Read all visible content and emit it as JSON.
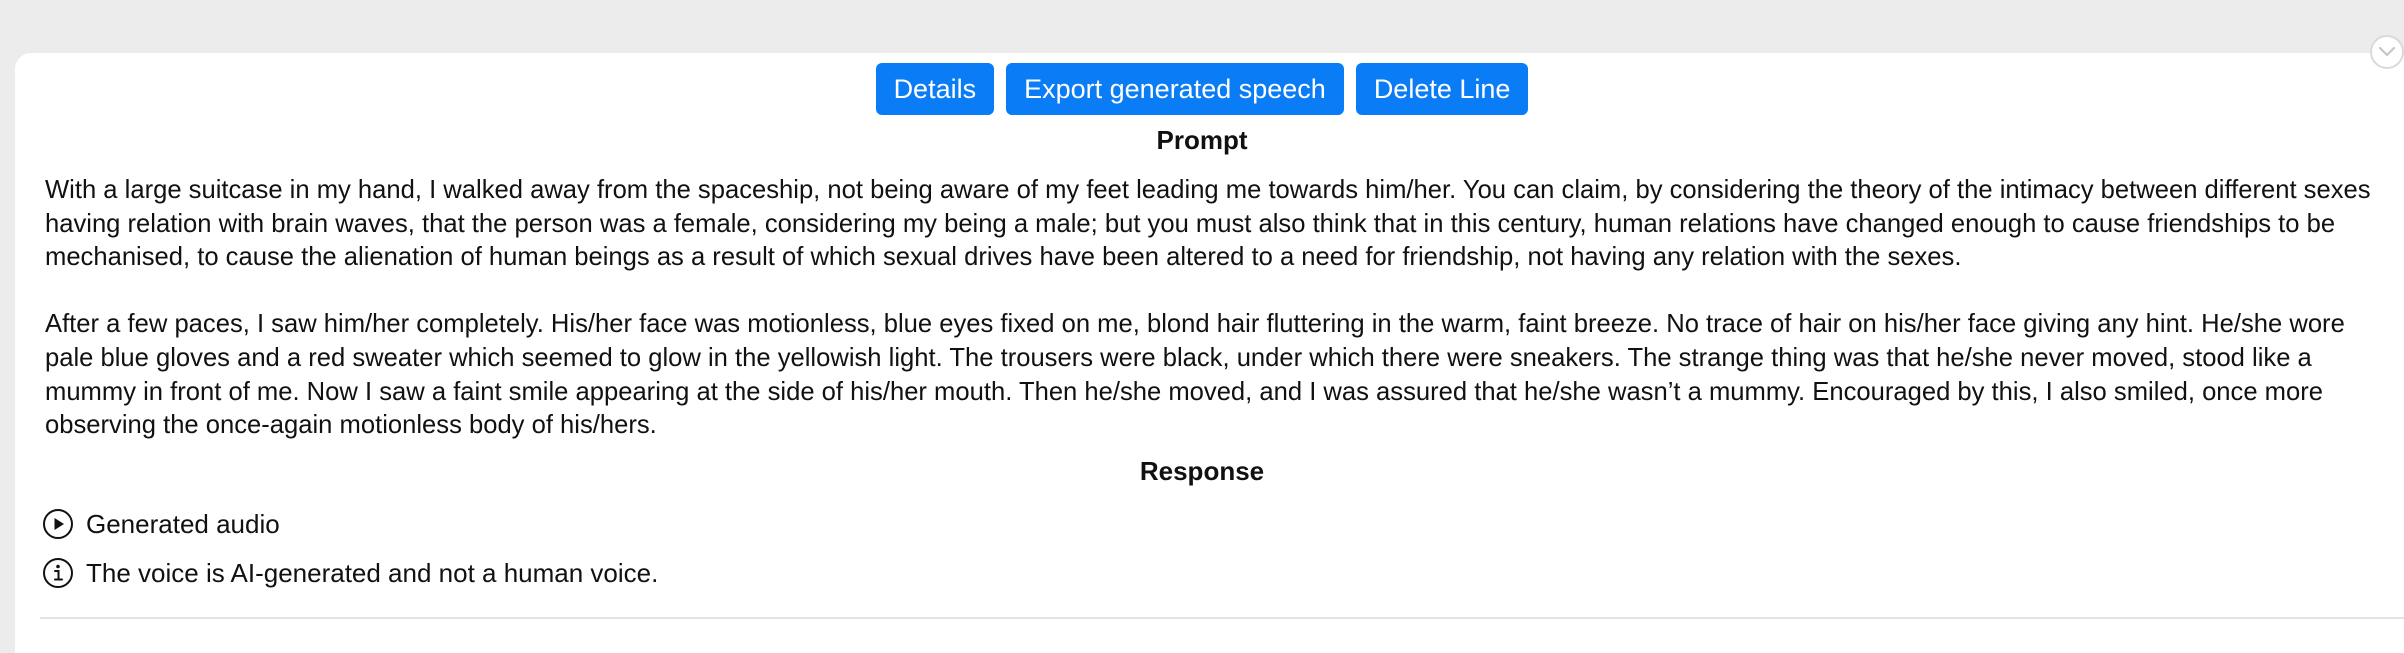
{
  "toolbar": {
    "details_label": "Details",
    "export_label": "Export generated speech",
    "delete_label": "Delete Line"
  },
  "prompt": {
    "heading": "Prompt",
    "paragraphs": [
      "With a large suitcase in my hand, I walked away from the spaceship, not being aware of my feet leading me towards him/her. You can claim, by considering the theory of the intimacy between different sexes having relation with brain waves, that the person was a female, considering my being a male; but you must also think that in this century, human relations have changed enough to cause friendships to be mechanised, to cause the alienation of human beings as a result of which sexual drives have been altered to a need for friendship, not having any relation with the sexes.",
      "After a few paces, I saw him/her completely. His/her face was motionless, blue eyes fixed on me, blond hair fluttering in the warm, faint breeze. No trace of hair on his/her face giving any hint. He/she wore pale blue gloves and a red sweater which seemed to glow in the yellowish light. The trousers were black, under which there were sneakers. The strange thing was that he/she never moved, stood like a mummy in front of me. Now I saw a faint smile appearing at the side of his/her mouth. Then he/she moved, and I was assured that he/she wasn’t a mummy. Encouraged by this, I also smiled, once more observing the once-again motionless body of his/hers."
    ]
  },
  "response": {
    "heading": "Response",
    "audio_label": "Generated audio",
    "disclaimer": "The voice is AI-generated and not a human voice."
  },
  "icons": {
    "collapse": "chevron-down-icon",
    "play": "play-circle-icon",
    "info": "info-circle-icon"
  },
  "colors": {
    "button_bg": "#0a7cf5",
    "page_bg": "#ececec",
    "card_bg": "#ffffff"
  }
}
